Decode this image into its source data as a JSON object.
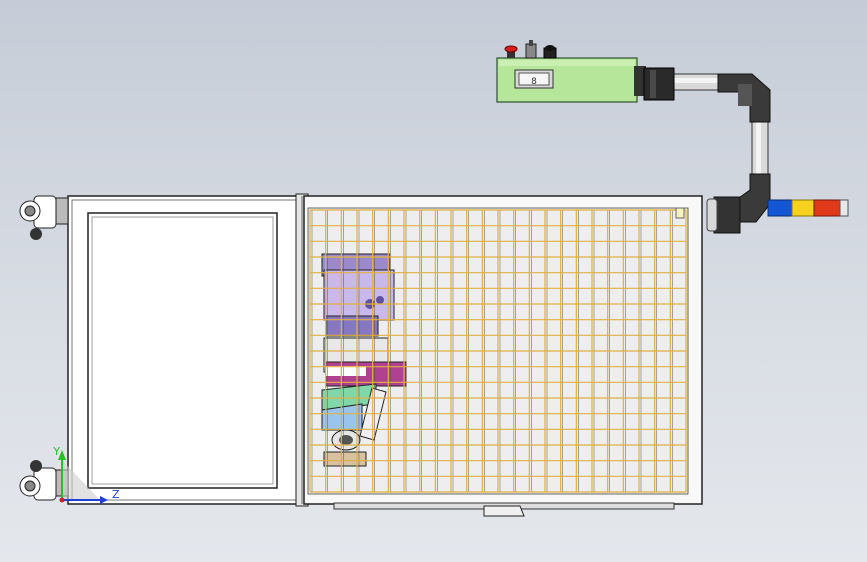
{
  "viewport": {
    "background_top": "#c6ccd7",
    "background_bottom": "#e4e7ec"
  },
  "control_box": {
    "color": "#b6e69a",
    "display_text": "8",
    "buttons": [
      "emergency-stop-button",
      "key-switch",
      "black-push-button"
    ]
  },
  "signal_tower": {
    "segments": [
      "blue",
      "yellow",
      "red",
      "white"
    ],
    "colors": {
      "blue": "#1456d6",
      "yellow": "#f4d21f",
      "red": "#e13a1a",
      "white": "#e8e8e8"
    }
  },
  "enclosure": {
    "guard_mesh_color": "#e0b043",
    "panel_color": "#ffffff",
    "outline_color": "#222222"
  },
  "triad": {
    "y_label": "Y",
    "z_label": "Z",
    "y_color": "#22c322",
    "z_color": "#1f3fd6"
  }
}
